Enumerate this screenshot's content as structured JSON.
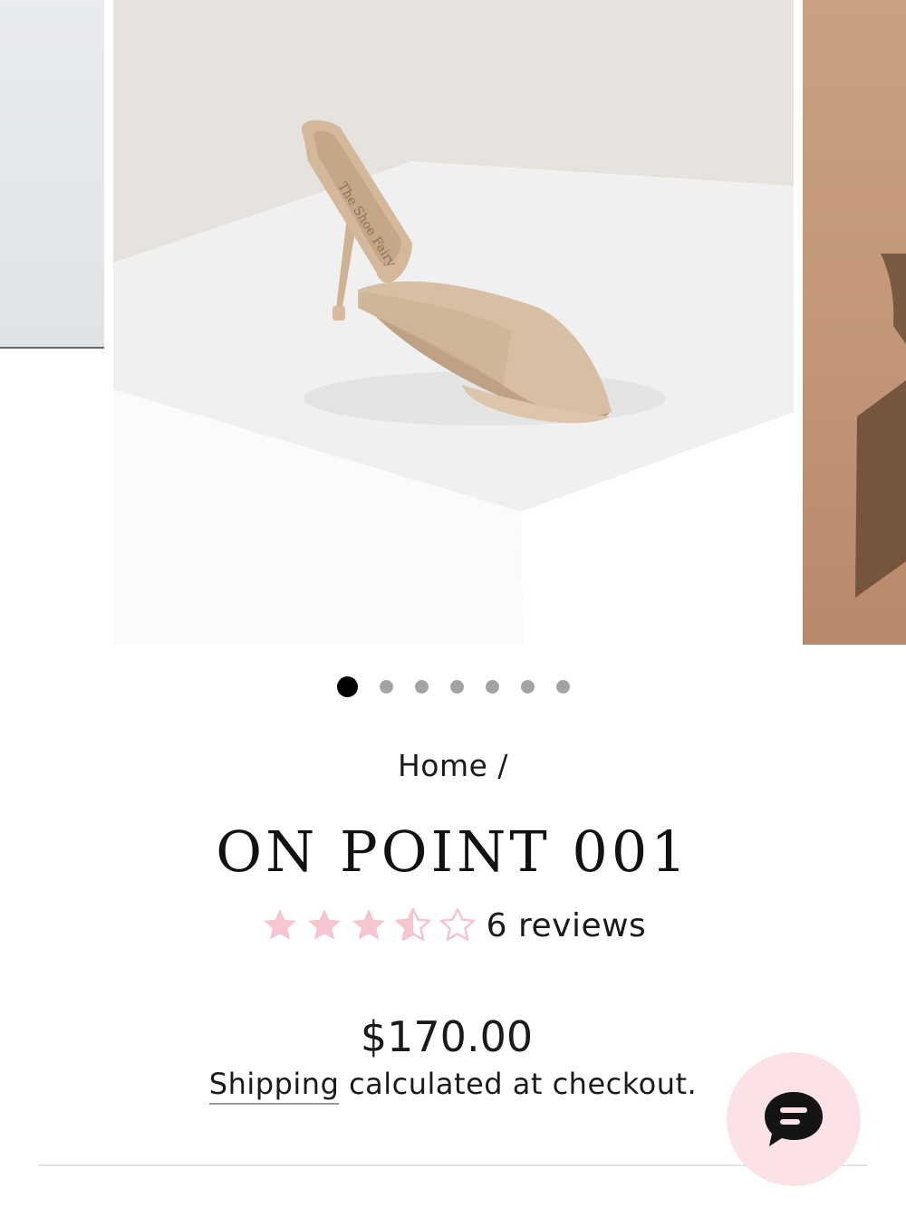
{
  "gallery": {
    "slide_count": 7,
    "active_slide": 1,
    "zoom_icon": "magnifier-icon",
    "insole_brand_script": "The Shoe Fairy"
  },
  "breadcrumb": {
    "home": "Home",
    "separator": "/"
  },
  "product": {
    "title": "ON POINT 001",
    "rating": 3.5,
    "rating_max": 5,
    "reviews_label": "6 reviews",
    "price": "$170.00",
    "shipping_link": "Shipping",
    "shipping_rest": "calculated at checkout."
  },
  "chat": {
    "icon": "chat-bubble-icon"
  },
  "colors": {
    "star_fill": "#f5c6cf",
    "dot_active": "#000000",
    "dot_inactive": "#a3a3a3",
    "chat_bg": "#fbe2e6",
    "text": "#1a1a1a"
  }
}
